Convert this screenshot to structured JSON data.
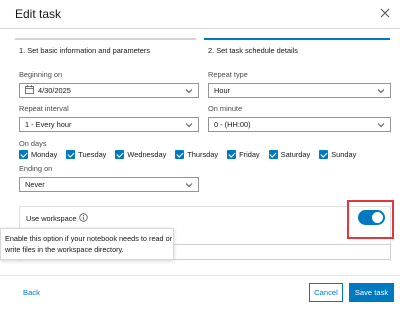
{
  "dialog": {
    "title": "Edit task",
    "close_icon": "close-icon"
  },
  "steps": [
    {
      "label": "1.  Set basic information and parameters",
      "active": false
    },
    {
      "label": "2.  Set task schedule details",
      "active": true
    }
  ],
  "form": {
    "beginning_on": {
      "label": "Beginning on",
      "value": "4/30/2025",
      "icon": "calendar-icon"
    },
    "repeat_type": {
      "label": "Repeat type",
      "value": "Hour"
    },
    "repeat_interval": {
      "label": "Repeat interval",
      "value": "1 - Every hour"
    },
    "on_minute": {
      "label": "On minute",
      "value": "0 - (HH:00)"
    },
    "on_days": {
      "label": "On days",
      "days": [
        {
          "label": "Monday",
          "checked": true
        },
        {
          "label": "Tuesday",
          "checked": true
        },
        {
          "label": "Wednesday",
          "checked": true
        },
        {
          "label": "Thursday",
          "checked": true
        },
        {
          "label": "Friday",
          "checked": true
        },
        {
          "label": "Saturday",
          "checked": true
        },
        {
          "label": "Sunday",
          "checked": true
        }
      ]
    },
    "ending_on": {
      "label": "Ending on",
      "value": "Never"
    }
  },
  "workspace": {
    "label": "Use workspace",
    "enabled": true,
    "tooltip": "Enable this option if your notebook needs to read or write files in the workspace directory."
  },
  "footer": {
    "back_label": "Back",
    "cancel_label": "Cancel",
    "save_label": "Save task"
  },
  "colors": {
    "accent": "#0079c1",
    "highlight": "#e0363c"
  }
}
